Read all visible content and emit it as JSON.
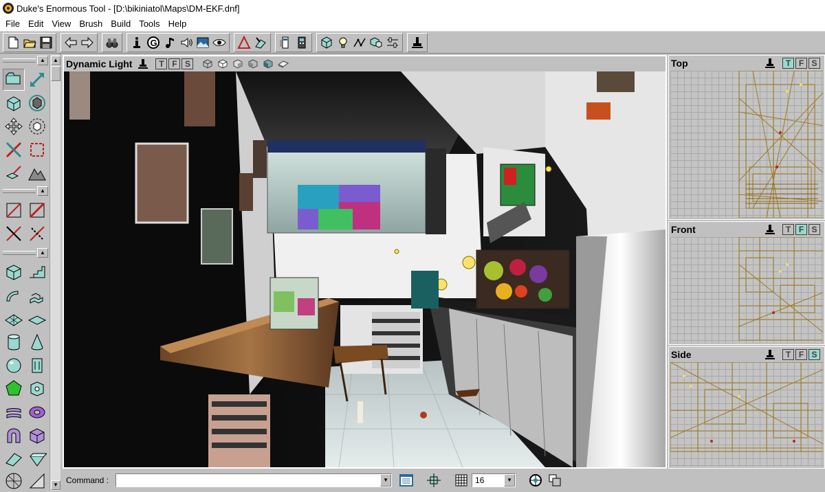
{
  "window": {
    "title": "Duke's Enormous Tool - [D:\\bikiniatol\\Maps\\DM-EKF.dnf]"
  },
  "menu": [
    "File",
    "Edit",
    "View",
    "Brush",
    "Build",
    "Tools",
    "Help"
  ],
  "toolbar": {
    "groups": [
      [
        "new-file-icon",
        "open-folder-icon",
        "save-icon"
      ],
      [
        "back-arrow-icon",
        "forward-arrow-icon"
      ],
      [
        "binoculars-icon"
      ],
      [
        "info-actor-icon",
        "g-icon",
        "music-note-icon",
        "speaker-icon",
        "texture-browser-icon",
        "eye-icon"
      ],
      [
        "triangle-mesh-icon",
        "rebuild-icon"
      ],
      [
        "calculator-icon",
        "remote-icon"
      ],
      [
        "box-icon",
        "lightbulb-icon",
        "path-icon",
        "group-icon",
        "sliders-icon"
      ],
      [
        "actor-stamp-icon"
      ]
    ]
  },
  "viewport": {
    "main_title": "Dynamic Light",
    "top_title": "Top",
    "front_title": "Front",
    "side_title": "Side",
    "tfs": [
      "T",
      "F",
      "S"
    ],
    "main_active": "",
    "top_active": "T",
    "front_active": "F",
    "side_active": "S"
  },
  "statusbar": {
    "command_label": "Command :",
    "command_value": "",
    "grid_size": "16"
  },
  "colors": {
    "wire": "#a07a20",
    "accent": "#9ad8d0",
    "face": "#c0c0c0"
  }
}
